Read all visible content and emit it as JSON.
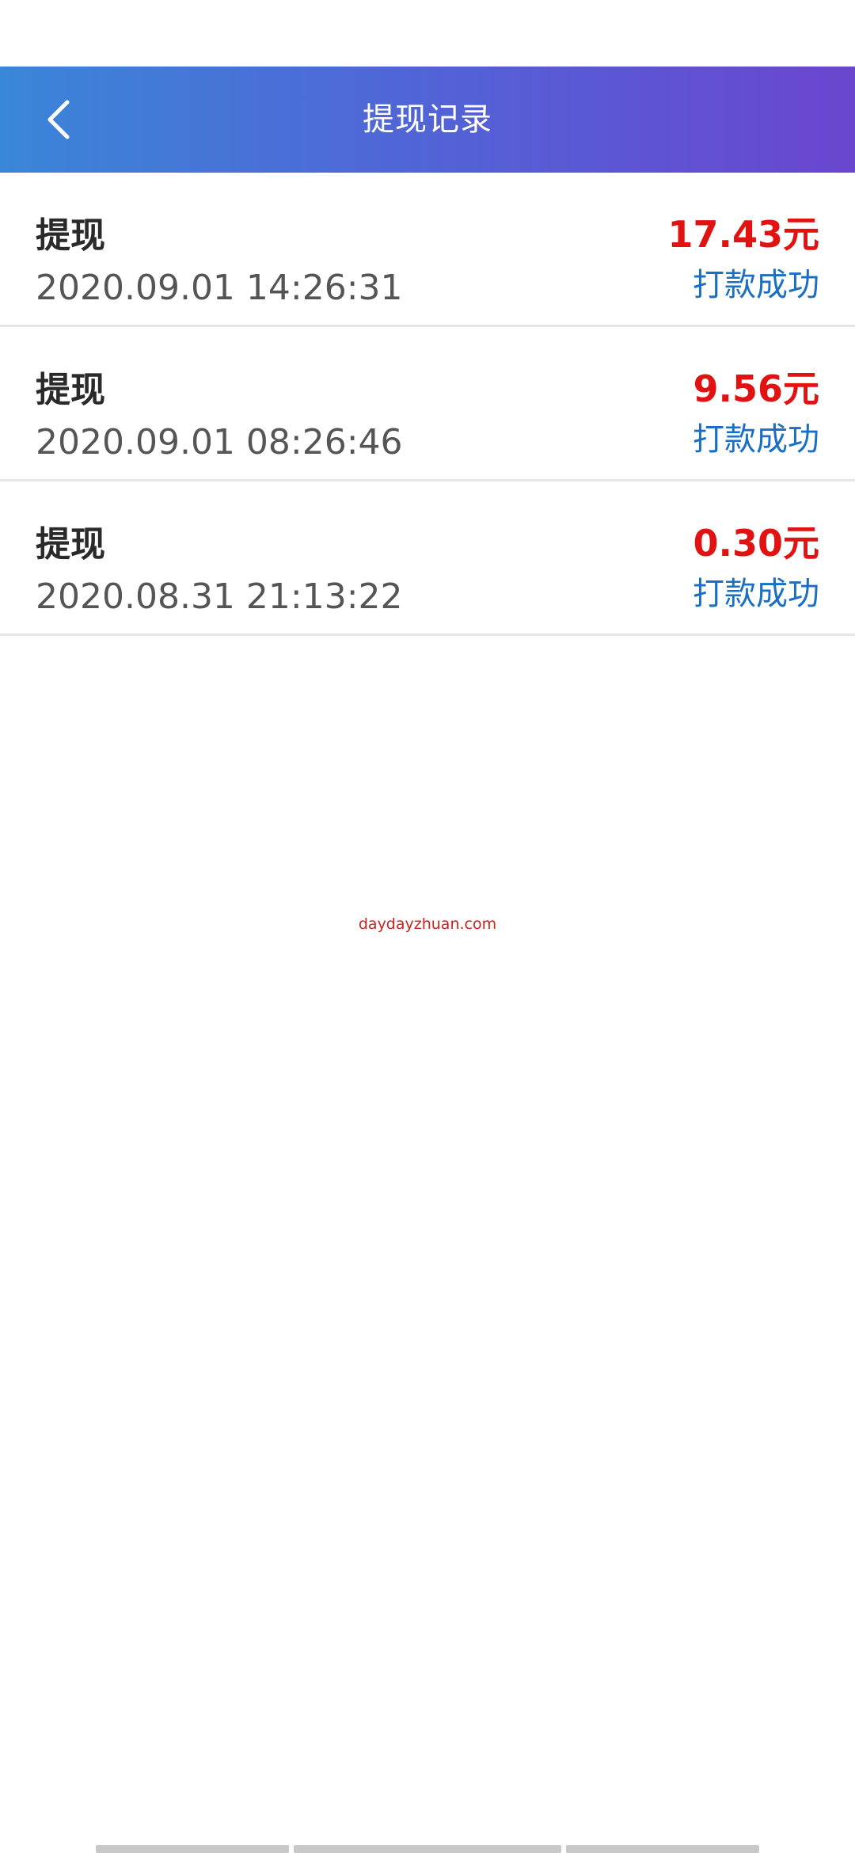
{
  "header": {
    "title": "提现记录",
    "back_icon": "chevron-left-icon",
    "gradient_colors": [
      "#3a86d8",
      "#6a46cf"
    ]
  },
  "records": [
    {
      "type": "提现",
      "time": "2020.09.01 14:26:31",
      "amount": "17.43元",
      "status": "打款成功"
    },
    {
      "type": "提现",
      "time": "2020.09.01 08:26:46",
      "amount": "9.56元",
      "status": "打款成功"
    },
    {
      "type": "提现",
      "time": "2020.08.31 21:13:22",
      "amount": "0.30元",
      "status": "打款成功"
    }
  ],
  "watermark": "daydayzhuan.com",
  "colors": {
    "amount": "#e01212",
    "status": "#1a6fc4"
  }
}
